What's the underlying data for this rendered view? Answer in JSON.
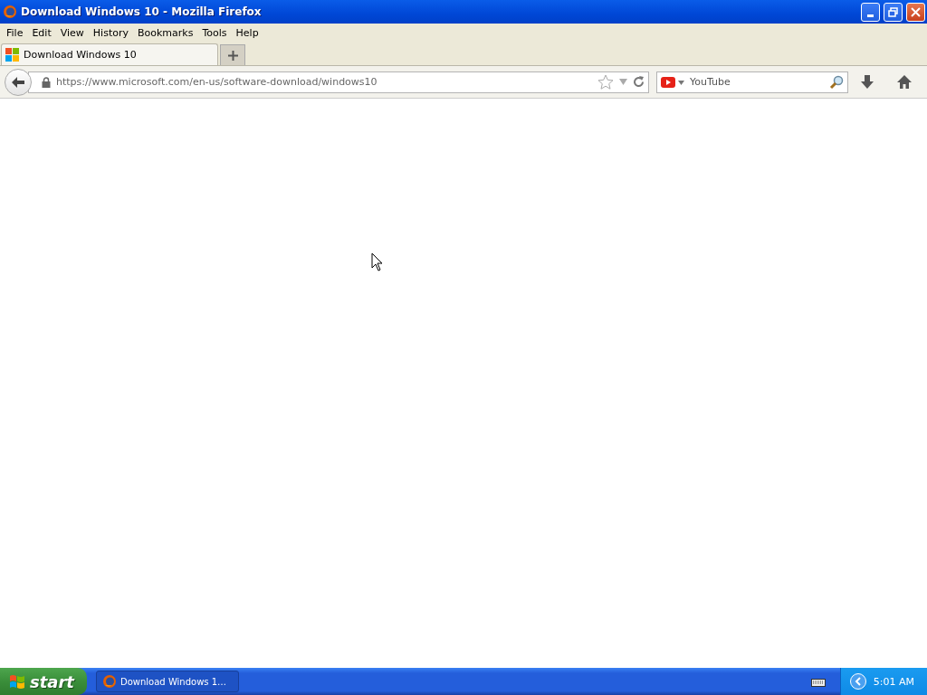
{
  "window": {
    "title": "Download Windows 10 - Mozilla Firefox"
  },
  "menu": [
    "File",
    "Edit",
    "View",
    "History",
    "Bookmarks",
    "Tools",
    "Help"
  ],
  "tabs": [
    {
      "label": "Download Windows 10",
      "selected": true
    }
  ],
  "address_bar": {
    "url": "https://www.microsoft.com/en-us/software-download/windows10"
  },
  "search": {
    "placeholder": "YouTube"
  },
  "taskbar": {
    "start": "start",
    "tasks": [
      {
        "label": "Download Windows 1…"
      }
    ],
    "clock": "5:01 AM"
  }
}
